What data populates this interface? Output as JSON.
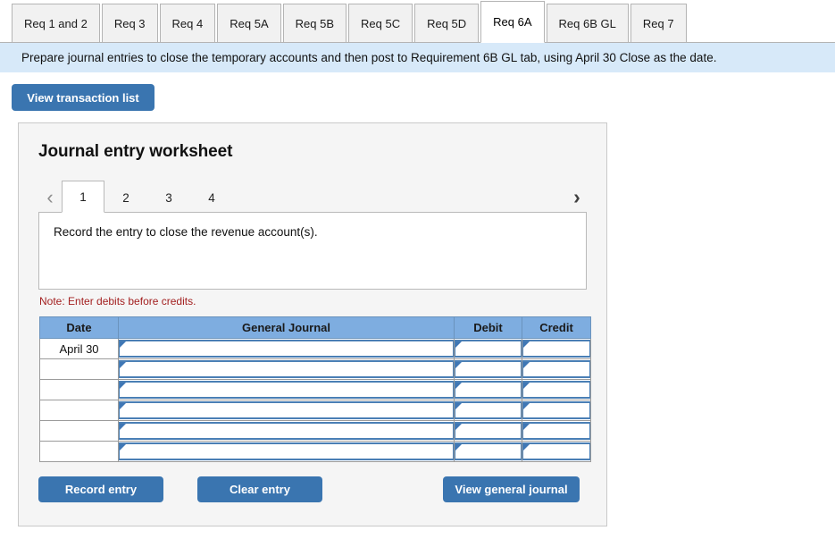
{
  "req_tabs": [
    {
      "label": "Req 1 and 2",
      "active": false
    },
    {
      "label": "Req 3",
      "active": false
    },
    {
      "label": "Req 4",
      "active": false
    },
    {
      "label": "Req 5A",
      "active": false
    },
    {
      "label": "Req 5B",
      "active": false
    },
    {
      "label": "Req 5C",
      "active": false
    },
    {
      "label": "Req 5D",
      "active": false
    },
    {
      "label": "Req 6A",
      "active": true
    },
    {
      "label": "Req 6B GL",
      "active": false
    },
    {
      "label": "Req 7",
      "active": false
    }
  ],
  "banner": {
    "text": "Prepare journal entries to close the temporary accounts and then post to Requirement 6B GL tab, using April 30 Close as the date."
  },
  "toolbar": {
    "view_transaction_list_label": "View transaction list"
  },
  "worksheet": {
    "title": "Journal entry worksheet",
    "prev_arrow": "‹",
    "next_arrow": "›",
    "pages": [
      {
        "label": "1",
        "active": true
      },
      {
        "label": "2",
        "active": false
      },
      {
        "label": "3",
        "active": false
      },
      {
        "label": "4",
        "active": false
      }
    ],
    "description": "Record the entry to close the revenue account(s).",
    "note": "Note: Enter debits before credits."
  },
  "journal_table": {
    "headers": [
      "Date",
      "General Journal",
      "Debit",
      "Credit"
    ],
    "rows": [
      {
        "date": "April 30",
        "general_journal": "",
        "debit": "",
        "credit": ""
      },
      {
        "date": "",
        "general_journal": "",
        "debit": "",
        "credit": ""
      },
      {
        "date": "",
        "general_journal": "",
        "debit": "",
        "credit": ""
      },
      {
        "date": "",
        "general_journal": "",
        "debit": "",
        "credit": ""
      },
      {
        "date": "",
        "general_journal": "",
        "debit": "",
        "credit": ""
      },
      {
        "date": "",
        "general_journal": "",
        "debit": "",
        "credit": ""
      }
    ]
  },
  "footer": {
    "record_entry_label": "Record entry",
    "clear_entry_label": "Clear entry",
    "view_general_journal_label": "View general journal"
  },
  "colors": {
    "accent_blue": "#3a75b0",
    "table_header_blue": "#7eade0",
    "banner_blue": "#d7e9f9",
    "note_red": "#a32020",
    "panel_gray": "#f5f5f5"
  }
}
